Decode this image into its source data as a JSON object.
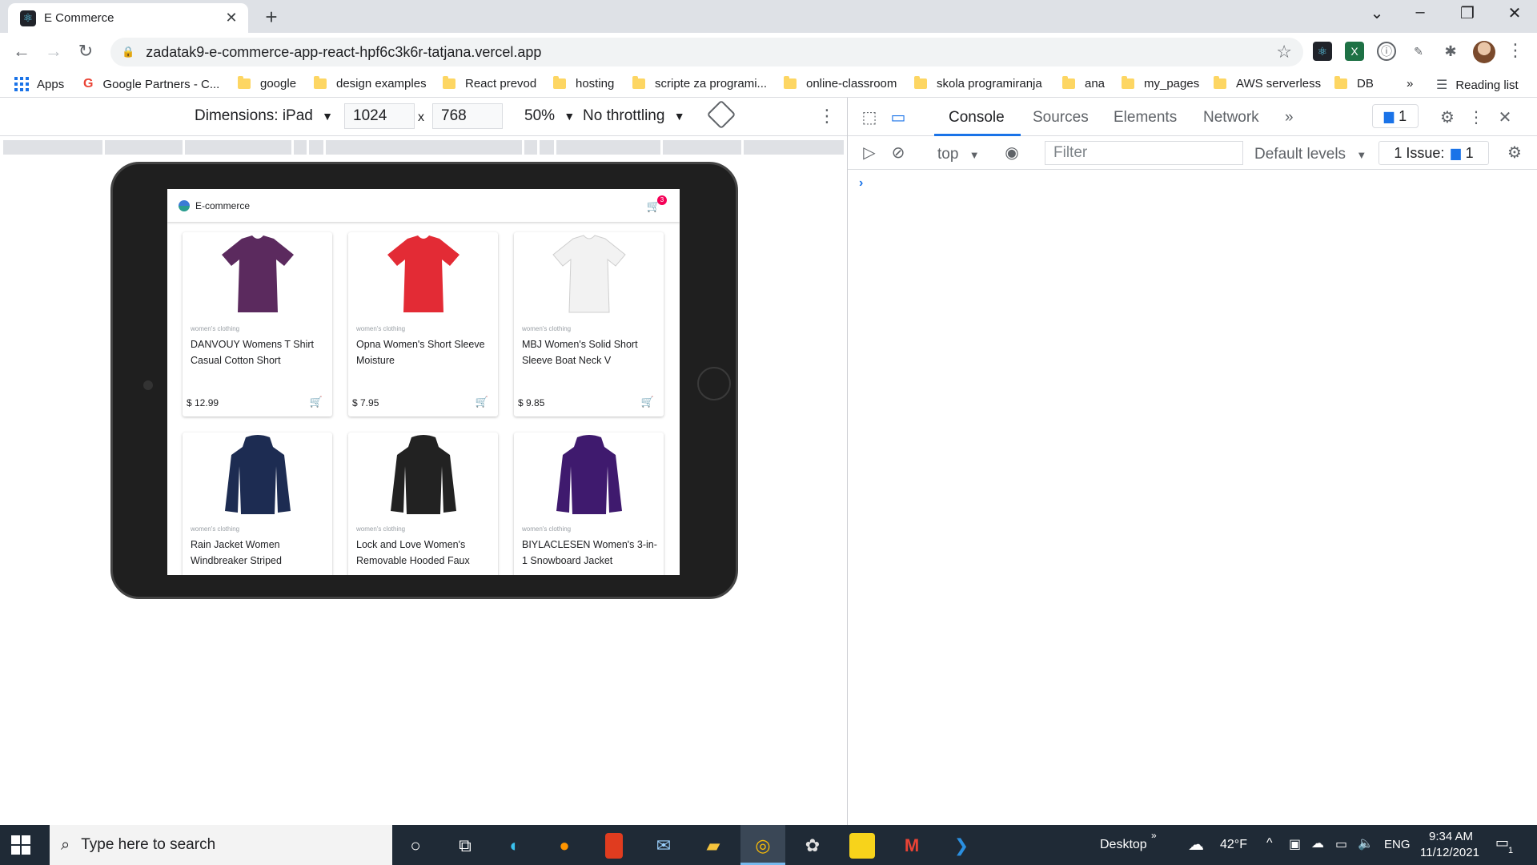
{
  "browser": {
    "tab_title": "E Commerce",
    "url": "zadatak9-e-commerce-app-react-hpf6c3k6r-tatjana.vercel.app",
    "bookmarks": [
      {
        "label": "Apps",
        "icon": "apps-grid-icon"
      },
      {
        "label": "Google Partners - C...",
        "icon": "google-icon"
      },
      {
        "label": "google",
        "icon": "folder-icon"
      },
      {
        "label": "design examples",
        "icon": "folder-icon"
      },
      {
        "label": "React prevod",
        "icon": "folder-icon"
      },
      {
        "label": "hosting",
        "icon": "folder-icon"
      },
      {
        "label": "scripte za programi...",
        "icon": "folder-icon"
      },
      {
        "label": "online-classroom",
        "icon": "folder-icon"
      },
      {
        "label": "skola programiranja",
        "icon": "folder-icon"
      },
      {
        "label": "ana",
        "icon": "folder-icon"
      },
      {
        "label": "my_pages",
        "icon": "folder-icon"
      },
      {
        "label": "AWS serverless",
        "icon": "folder-icon"
      },
      {
        "label": "DB",
        "icon": "folder-icon"
      }
    ],
    "bookmarks_more": "»",
    "reading_list": "Reading list"
  },
  "device_toolbar": {
    "dimensions_label": "Dimensions: iPad",
    "width": "1024",
    "times": "x",
    "height": "768",
    "zoom": "50%",
    "throttling": "No throttling"
  },
  "app": {
    "brand": "E-commerce",
    "cart_count": "3",
    "products": [
      {
        "category": "women's clothing",
        "title": "DANVOUY Womens T Shirt Casual Cotton Short",
        "price": "$ 12.99",
        "color": "#5b2a5e",
        "kind": "tshirt"
      },
      {
        "category": "women's clothing",
        "title": "Opna Women's Short Sleeve Moisture",
        "price": "$ 7.95",
        "color": "#e32b35",
        "kind": "tshirt"
      },
      {
        "category": "women's clothing",
        "title": "MBJ Women's Solid Short Sleeve Boat Neck V",
        "price": "$ 9.85",
        "color": "#f2f2f2",
        "kind": "tshirt"
      },
      {
        "category": "women's clothing",
        "title": "Rain Jacket Women Windbreaker Striped",
        "price": "",
        "color": "#1d2c52",
        "kind": "jacket"
      },
      {
        "category": "women's clothing",
        "title": "Lock and Love Women's Removable Hooded Faux",
        "price": "",
        "color": "#222222",
        "kind": "jacket"
      },
      {
        "category": "women's clothing",
        "title": "BIYLACLESEN Women's 3-in-1 Snowboard Jacket",
        "price": "",
        "color": "#3f1a6e",
        "kind": "jacket"
      }
    ]
  },
  "devtools": {
    "tabs": [
      "Console",
      "Sources",
      "Elements",
      "Network"
    ],
    "more_tabs": "»",
    "messages_count": "1",
    "context": "top",
    "filter_placeholder": "Filter",
    "levels": "Default levels",
    "issues_label": "1 Issue:",
    "issues_count": "1",
    "prompt": "›"
  },
  "taskbar": {
    "search_placeholder": "Type here to search",
    "desktop_label": "Desktop",
    "desktop_more": "»",
    "temperature": "42°F",
    "language": "ENG",
    "time": "9:34 AM",
    "date": "11/12/2021",
    "notifications": "1"
  },
  "colors": {
    "accent": "#1a73e8",
    "badge": "#f50057",
    "taskbar": "#1f2a36"
  }
}
